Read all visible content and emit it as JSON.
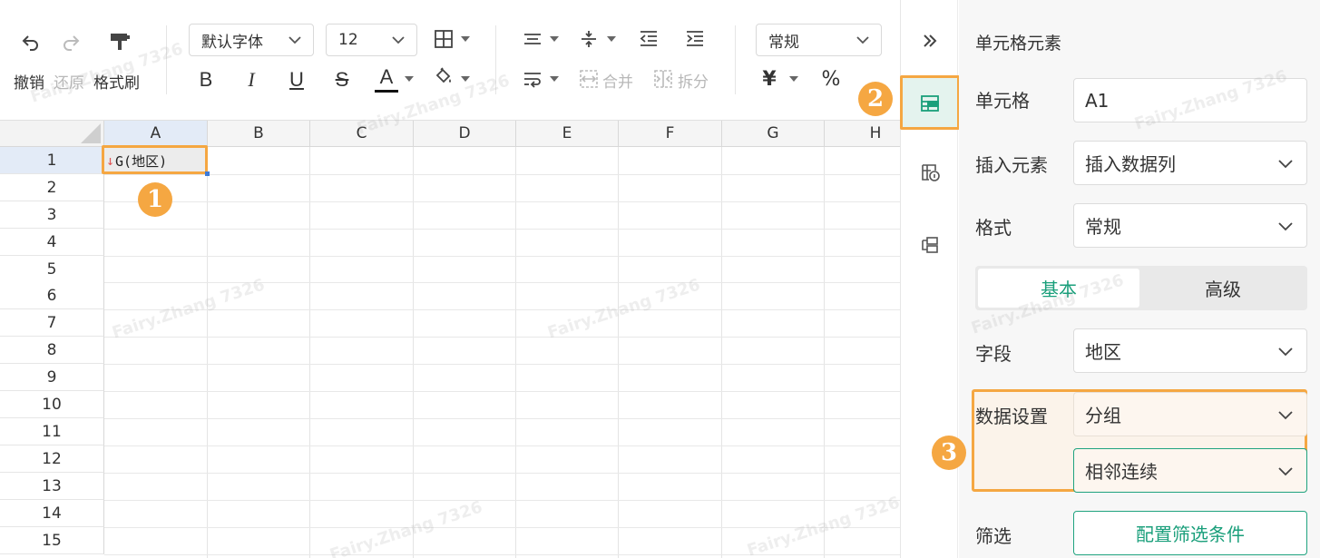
{
  "toolbar": {
    "undo_label": "撤销",
    "redo_label": "还原",
    "format_painter_label": "格式刷",
    "font_family": "默认字体",
    "font_size": "12",
    "merge_label": "合并",
    "split_label": "拆分",
    "number_format": "常规",
    "currency_symbol": "¥",
    "percent_symbol": "%",
    "bold": "B",
    "italic": "I",
    "underline": "U",
    "strikethrough": "S",
    "font_color": "A"
  },
  "grid": {
    "columns": [
      "A",
      "B",
      "C",
      "D",
      "E",
      "F",
      "G",
      "H"
    ],
    "rows": [
      "1",
      "2",
      "3",
      "4",
      "5",
      "6",
      "7",
      "8",
      "9",
      "10",
      "11",
      "12",
      "13",
      "14",
      "15"
    ],
    "cell_a1": {
      "arrow": "↓",
      "text": "G(地区)"
    }
  },
  "badges": [
    "1",
    "2",
    "3"
  ],
  "watermark": "Fairy.Zhang 7326",
  "panel": {
    "title": "单元格元素",
    "cell_label": "单元格",
    "cell_value": "A1",
    "insert_label": "插入元素",
    "insert_value": "插入数据列",
    "format_label": "格式",
    "format_value": "常规",
    "tab_basic": "基本",
    "tab_advanced": "高级",
    "field_label": "字段",
    "field_value": "地区",
    "data_setting_label": "数据设置",
    "data_setting_value": "分组",
    "data_setting_sub_value": "相邻连续",
    "filter_label": "筛选",
    "filter_button": "配置筛选条件"
  },
  "colors": {
    "accent_green": "#1a9f7b",
    "highlight_orange": "#f5a742",
    "selection_blue": "#3d7bd9"
  }
}
